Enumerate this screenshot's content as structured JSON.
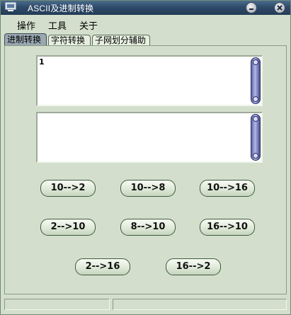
{
  "window": {
    "title": "ASCII及进制转换"
  },
  "menu": {
    "items": [
      "操作",
      "工具",
      "关于"
    ]
  },
  "tabs": [
    {
      "label": "进制转换",
      "active": true
    },
    {
      "label": "字符转换",
      "active": false
    },
    {
      "label": "子网划分辅助",
      "active": false
    }
  ],
  "input": {
    "value": "1"
  },
  "output": {
    "value": ""
  },
  "buttons": {
    "b10_2": "10-->2",
    "b10_8": "10-->8",
    "b10_16": "10-->16",
    "b2_10": "2-->10",
    "b8_10": "8-->10",
    "b16_10": "16-->10",
    "b2_16": "2-->16",
    "b16_2": "16-->2"
  },
  "status": {
    "pane1": "",
    "pane2": ""
  }
}
